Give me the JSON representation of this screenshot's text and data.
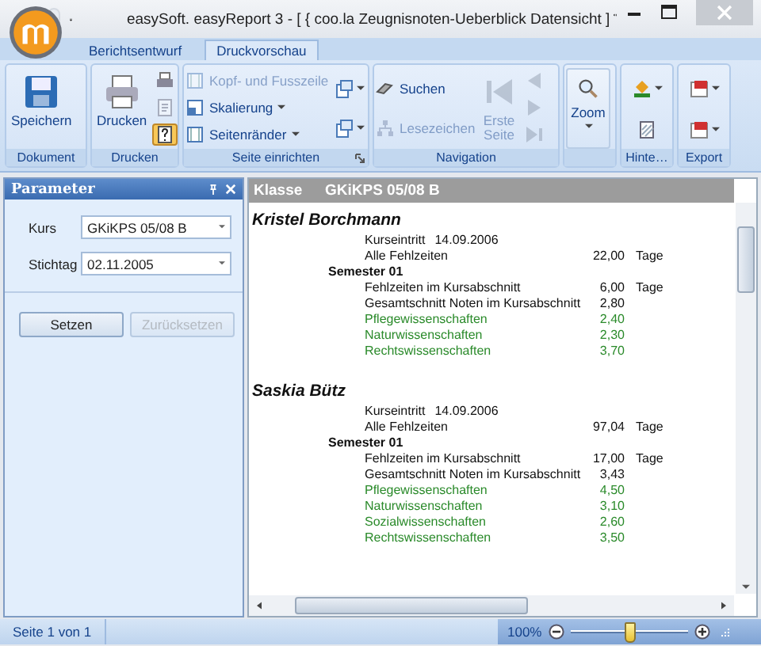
{
  "window": {
    "title": "easySoft. easyReport 3 - [ { coo.la Zeugnisnoten-Ueberblick Datensicht ]"
  },
  "ribbon": {
    "tabs": [
      {
        "label": "Berichtsentwurf",
        "selected": false
      },
      {
        "label": "Druckvorschau",
        "selected": true
      }
    ],
    "groups": [
      {
        "label": "Dokument",
        "buttons": [
          {
            "label": "Speichern",
            "disabled": false
          }
        ]
      },
      {
        "label": "Drucken",
        "buttons": [
          {
            "label": "Drucken",
            "disabled": false
          },
          {
            "disabled": false
          },
          {
            "disabled": true
          },
          {
            "disabled": false,
            "on": true
          }
        ]
      },
      {
        "label": "Seite einrichten",
        "buttons": [
          {
            "label": "Kopf- und Fusszeile",
            "disabled": true
          },
          {
            "label": "Skalierung",
            "disabled": false
          },
          {
            "label": "Seitenränder",
            "disabled": false
          },
          {
            "disabled": false
          },
          {
            "disabled": false
          }
        ]
      },
      {
        "label": "Navigation",
        "buttons": [
          {
            "label": "Suchen",
            "disabled": false
          },
          {
            "label": "Lesezeichen",
            "disabled": true
          },
          {
            "label": "Erste Seite",
            "disabled": true
          },
          {
            "disabled": true
          },
          {
            "disabled": true
          },
          {
            "disabled": true
          }
        ]
      },
      {
        "buttons": [
          {
            "label": "Zoom",
            "disabled": false,
            "on": true
          }
        ]
      },
      {
        "label": "Hinte…",
        "buttons": [
          {
            "disabled": false
          },
          {
            "disabled": false
          }
        ]
      },
      {
        "label": "Export",
        "buttons": [
          {
            "disabled": false
          },
          {
            "disabled": false
          }
        ]
      }
    ]
  },
  "parameters": {
    "title": "Parameter",
    "fields": [
      {
        "label": "Kurs",
        "value": "GKiKPS 05/08 B"
      },
      {
        "label": "Stichtag",
        "value": "02.11.2005"
      }
    ],
    "buttons": [
      {
        "label": "Setzen",
        "disabled": false
      },
      {
        "label": "Zurücksetzen",
        "disabled": true
      }
    ]
  },
  "report": {
    "header": {
      "label": "Klasse",
      "value": "GKiKPS 05/08 B"
    },
    "students": [
      {
        "name": "Kristel Borchmann",
        "entry": {
          "label": "Kurseintritt",
          "value": "14.09.2006"
        },
        "total": {
          "label": "Alle Fehlzeiten",
          "value": "22,00",
          "unit": "Tage"
        },
        "semesters": [
          {
            "label": "Semester 01",
            "rows": [
              {
                "kind": "absence",
                "label": "Fehlzeiten im Kursabschnitt",
                "value": "6,00",
                "unit": "Tage"
              },
              {
                "kind": "average",
                "label": "Gesamtschnitt Noten im Kursabschnitt",
                "value": "2,80"
              },
              {
                "kind": "subject",
                "label": "Pflegewissenschaften",
                "value": "2,40"
              },
              {
                "kind": "subject",
                "label": "Naturwissenschaften",
                "value": "2,30"
              },
              {
                "kind": "subject",
                "label": "Rechtswissenschaften",
                "value": "3,70"
              }
            ]
          }
        ]
      },
      {
        "name": "Saskia Bütz",
        "entry": {
          "label": "Kurseintritt",
          "value": "14.09.2006"
        },
        "total": {
          "label": "Alle Fehlzeiten",
          "value": "97,04",
          "unit": "Tage"
        },
        "semesters": [
          {
            "label": "Semester 01",
            "rows": [
              {
                "kind": "absence",
                "label": "Fehlzeiten im Kursabschnitt",
                "value": "17,00",
                "unit": "Tage"
              },
              {
                "kind": "average",
                "label": "Gesamtschnitt Noten im Kursabschnitt",
                "value": "3,43"
              },
              {
                "kind": "subject",
                "label": "Pflegewissenschaften",
                "value": "4,50"
              },
              {
                "kind": "subject",
                "label": "Naturwissenschaften",
                "value": "3,10"
              },
              {
                "kind": "subject",
                "label": "Sozialwissenschaften",
                "value": "2,60"
              },
              {
                "kind": "subject",
                "label": "Rechtswissenschaften",
                "value": "3,50"
              }
            ]
          }
        ]
      }
    ]
  },
  "status_bar": {
    "page": "Seite 1 von 1",
    "zoom": {
      "reading": "100%",
      "level": 0.5
    }
  }
}
